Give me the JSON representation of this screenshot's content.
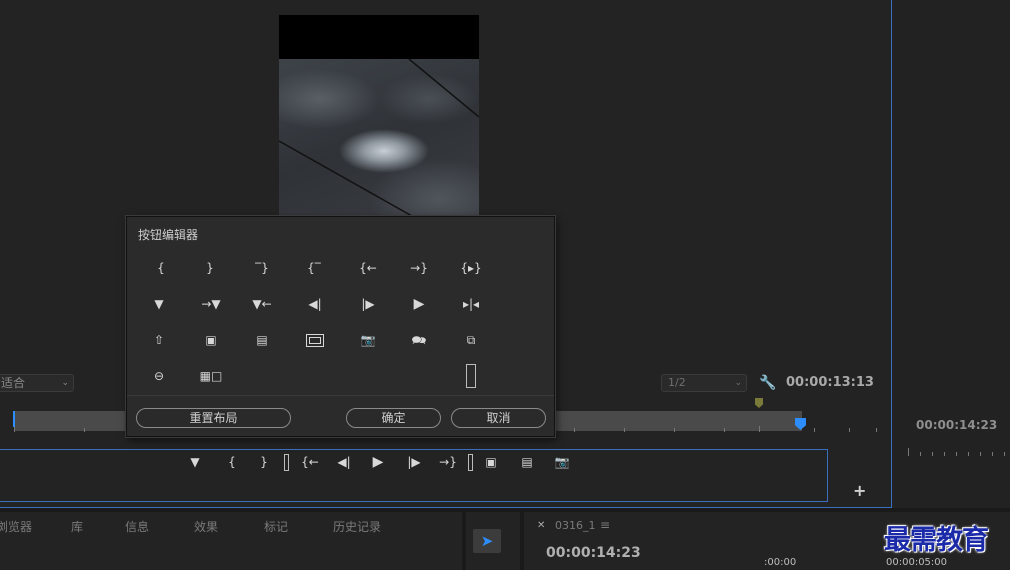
{
  "program_monitor": {
    "zoom_left": "适合",
    "resolution": "1/2",
    "timecode": "00:00:13:13"
  },
  "source_right": {
    "timecode": "00:00:14:23"
  },
  "button_editor": {
    "title": "按钮编辑器",
    "reset_label": "重置布局",
    "ok_label": "确定",
    "cancel_label": "取消",
    "grid_icons": [
      [
        "mark-in",
        "mark-out",
        "clear-in",
        "clear-out",
        "go-to-in",
        "go-to-out",
        "play-in-to-out"
      ],
      [
        "add-marker",
        "go-to-next-marker",
        "go-to-previous-marker",
        "step-back",
        "step-forward",
        "play-stop",
        "trim-toggle"
      ],
      [
        "lift",
        "extract",
        "overwrite",
        "safe-margins",
        "export-frame",
        "closed-captions",
        "comparison-view"
      ],
      [
        "vr-video",
        "multi-camera"
      ]
    ]
  },
  "transport": {
    "icons": [
      "add-marker",
      "mark-in",
      "mark-out",
      "spacer",
      "go-to-in",
      "step-back",
      "play",
      "step-forward",
      "go-to-out",
      "spacer",
      "lift",
      "extract",
      "export-frame"
    ]
  },
  "bottom_tabs": [
    "浏览器",
    "库",
    "信息",
    "效果",
    "标记",
    "历史记录"
  ],
  "timeline_panel": {
    "sequence_name": "0316_1",
    "timecode": "00:00:14:23",
    "ruler_start": ":00:00",
    "ruler_mark": "00:00:05:00"
  },
  "watermark": "最需教育",
  "colors": {
    "accent": "#2d8cff",
    "panel_border": "#3a6fbf",
    "dialog_bg": "#2b2b2b",
    "watermark": "#1b2aa8"
  }
}
